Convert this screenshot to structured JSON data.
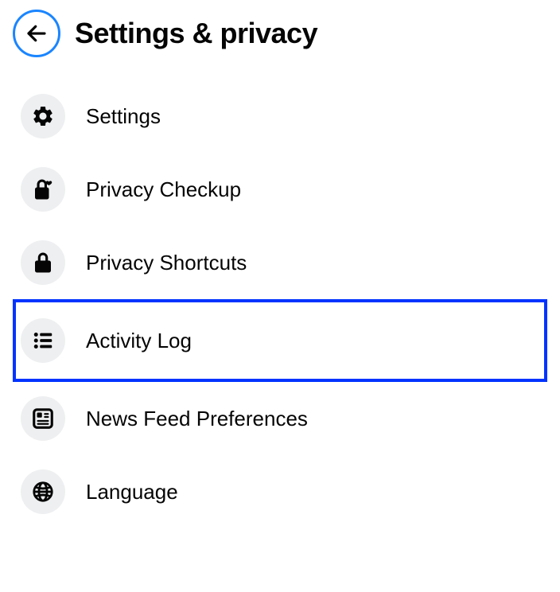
{
  "header": {
    "title": "Settings & privacy"
  },
  "menu": {
    "items": [
      {
        "label": "Settings",
        "icon": "gear-icon",
        "highlighted": false
      },
      {
        "label": "Privacy Checkup",
        "icon": "lock-heart-icon",
        "highlighted": false
      },
      {
        "label": "Privacy Shortcuts",
        "icon": "lock-icon",
        "highlighted": false
      },
      {
        "label": "Activity Log",
        "icon": "list-icon",
        "highlighted": true
      },
      {
        "label": "News Feed Preferences",
        "icon": "news-feed-icon",
        "highlighted": false
      },
      {
        "label": "Language",
        "icon": "globe-icon",
        "highlighted": false
      }
    ]
  }
}
